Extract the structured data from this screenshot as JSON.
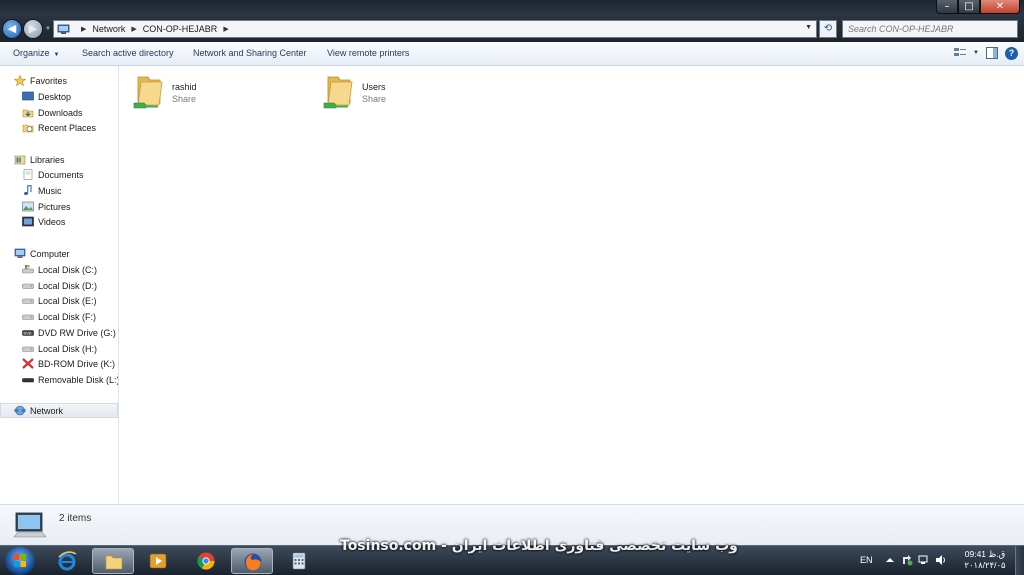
{
  "window": {
    "controls": {
      "minimize": "–",
      "maximize": "□",
      "close": "✕"
    }
  },
  "address": {
    "crumbs": [
      "Network",
      "CON-OP-HEJABR"
    ],
    "search_placeholder": "Search CON-OP-HEJABR"
  },
  "toolbar": {
    "organize": "Organize",
    "search_ad": "Search active directory",
    "network_sharing": "Network and Sharing Center",
    "view_printers": "View remote printers"
  },
  "nav": {
    "favorites": {
      "label": "Favorites",
      "items": [
        "Desktop",
        "Downloads",
        "Recent Places"
      ]
    },
    "libraries": {
      "label": "Libraries",
      "items": [
        "Documents",
        "Music",
        "Pictures",
        "Videos"
      ]
    },
    "computer": {
      "label": "Computer",
      "items": [
        "Local Disk (C:)",
        "Local Disk (D:)",
        "Local Disk (E:)",
        "Local Disk (F:)",
        "DVD RW Drive (G:) M",
        "Local Disk (H:)",
        "BD-ROM Drive (K:) D",
        "Removable Disk (L:)"
      ]
    },
    "network": {
      "label": "Network"
    }
  },
  "content": {
    "items": [
      {
        "name": "rashid",
        "type": "Share"
      },
      {
        "name": "Users",
        "type": "Share"
      }
    ]
  },
  "details": {
    "count": "2 items"
  },
  "taskbar": {
    "watermark": "Tosinso.com - وب سایت تخصصی فناوری اطلاعات ایران",
    "language": "EN",
    "time": "09:41 ق.ظ",
    "date": "۲۰۱۸/۲۴/۰۵"
  },
  "colors": {
    "link": "#1e395b",
    "folder": "#f3d27a",
    "accent": "#1c5fb0"
  }
}
